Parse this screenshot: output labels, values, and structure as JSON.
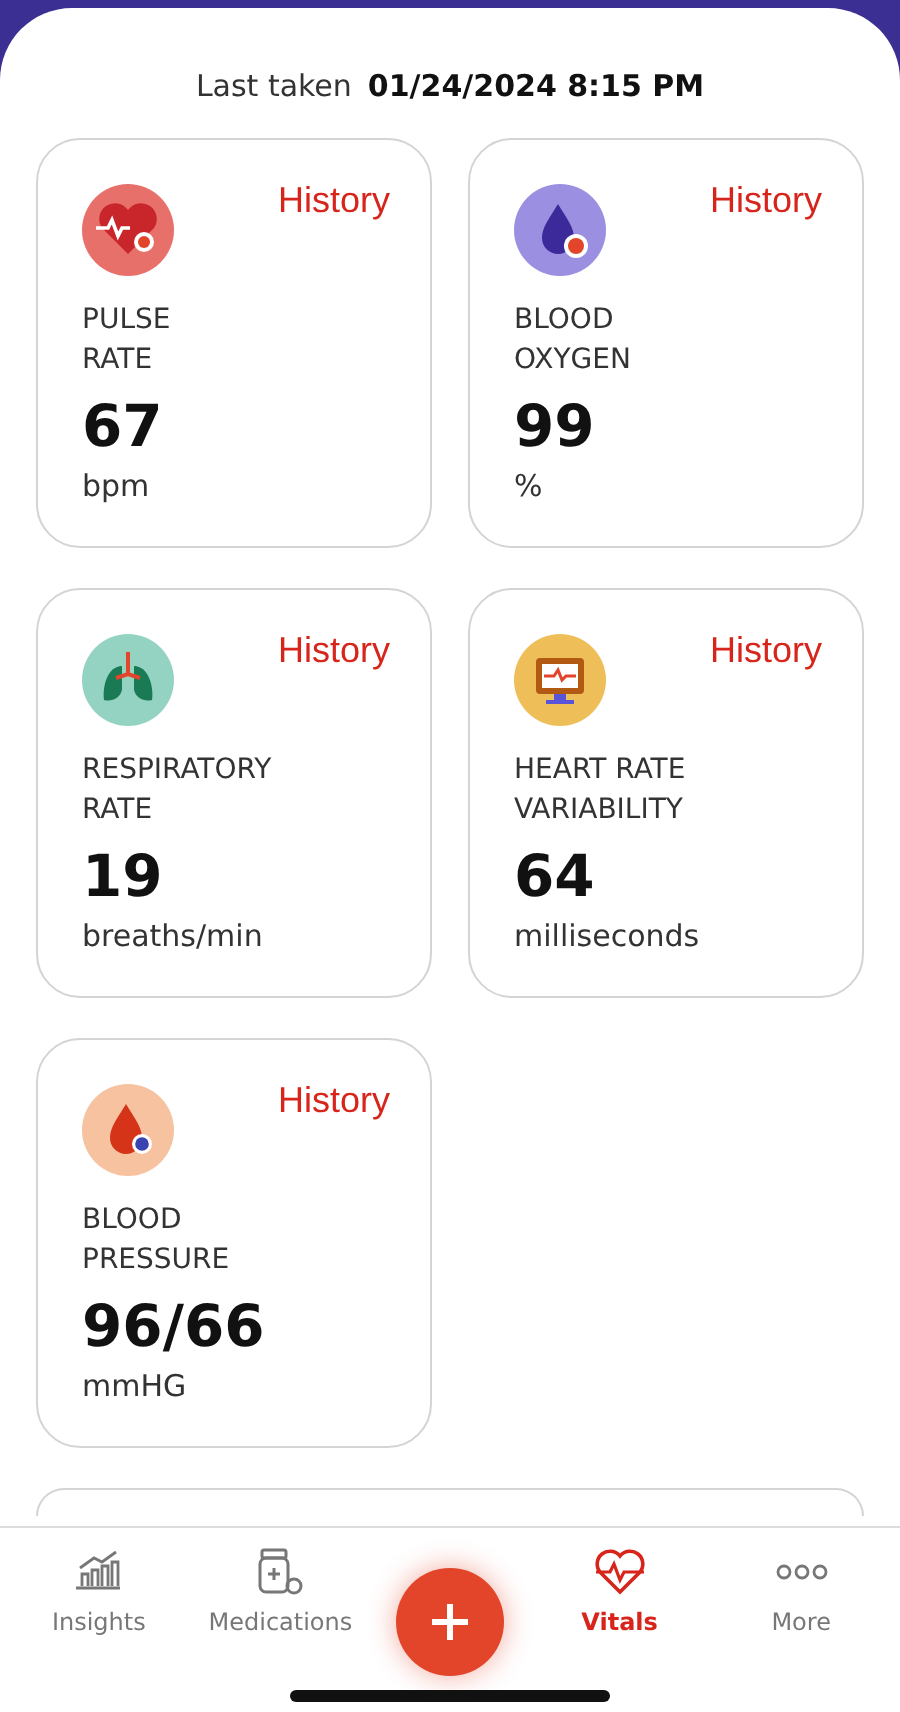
{
  "header": {
    "label": "Last taken",
    "value": "01/24/2024 8:15 PM"
  },
  "cards": [
    {
      "kind": "pulse",
      "link": "History",
      "title": [
        "PULSE",
        "RATE"
      ],
      "value": "67",
      "unit": "bpm"
    },
    {
      "kind": "oxygen",
      "link": "History",
      "title": [
        "BLOOD",
        "OXYGEN"
      ],
      "value": "99",
      "unit": "%"
    },
    {
      "kind": "respiratory",
      "link": "History",
      "title": [
        "RESPIRATORY",
        "RATE"
      ],
      "value": "19",
      "unit": "breaths/min"
    },
    {
      "kind": "hrv",
      "link": "History",
      "title": [
        "HEART RATE",
        "VARIABILITY"
      ],
      "value": "64",
      "unit": "milliseconds"
    },
    {
      "kind": "pressure",
      "link": "History",
      "title": [
        "BLOOD",
        "PRESSURE"
      ],
      "value": "96/66",
      "unit": "mmHG"
    }
  ],
  "tab_bar": [
    {
      "kind": "insights",
      "label": "Insights",
      "selected": false
    },
    {
      "kind": "medications",
      "label": "Medications",
      "selected": false
    },
    {
      "kind": "add"
    },
    {
      "kind": "vitals",
      "label": "Vitals",
      "selected": true
    },
    {
      "kind": "more",
      "label": "More",
      "selected": false
    }
  ]
}
